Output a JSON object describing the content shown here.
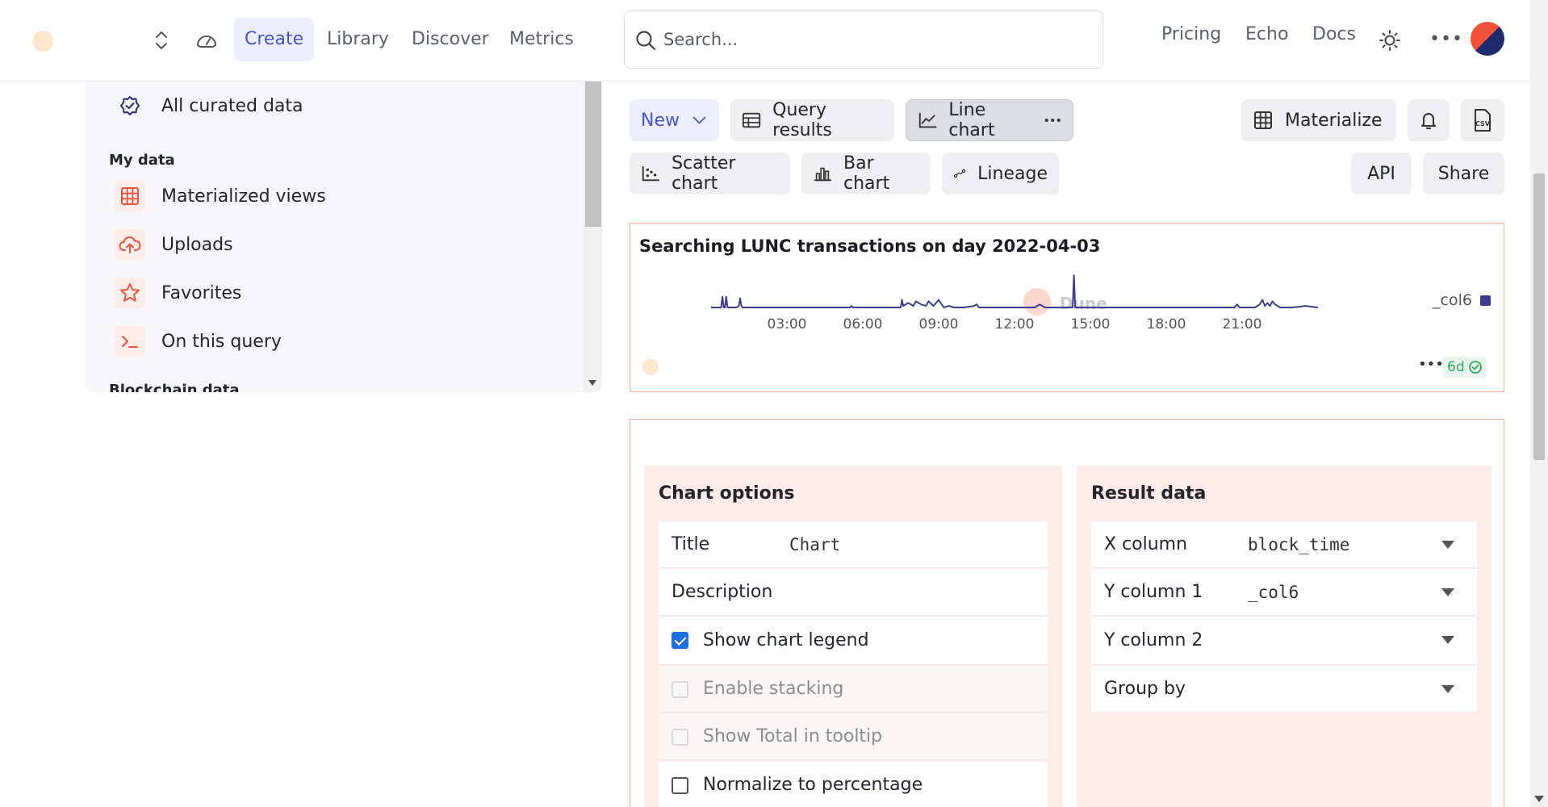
{
  "nav": {
    "items": [
      {
        "label": "Create"
      },
      {
        "label": "Library"
      },
      {
        "label": "Discover"
      },
      {
        "label": "Metrics"
      }
    ],
    "search_placeholder": "Search...",
    "right_links": [
      {
        "label": "Pricing"
      },
      {
        "label": "Echo"
      },
      {
        "label": "Docs"
      }
    ],
    "more_label": "•••"
  },
  "sidebar": {
    "curated": {
      "label": "All curated data",
      "icon": "shield-check-icon"
    },
    "my_data_heading": "My data",
    "items": [
      {
        "label": "Materialized views",
        "icon": "grid-table-icon"
      },
      {
        "label": "Uploads",
        "icon": "cloud-upload-icon"
      },
      {
        "label": "Favorites",
        "icon": "star-icon"
      },
      {
        "label": "On this query",
        "icon": "terminal-icon"
      }
    ],
    "blockchain_heading": "Blockchain data"
  },
  "toolbar": {
    "new_label": "New",
    "query_results": "Query results",
    "line_chart": "Line chart",
    "materialize": "Materialize",
    "scatter_chart": "Scatter chart",
    "bar_chart": "Bar chart",
    "lineage": "Lineage",
    "api": "API",
    "share": "Share"
  },
  "chart": {
    "more_label": "•••",
    "age_badge": "6d",
    "watermark": "Dune"
  },
  "chart_data": {
    "type": "line",
    "title": "Searching LUNC transactions on day 2022-04-03",
    "x_tick_labels": [
      "03:00",
      "06:00",
      "09:00",
      "12:00",
      "15:00",
      "18:00",
      "21:00"
    ],
    "xlim": [
      "00:00",
      "24:00"
    ],
    "series": [
      {
        "name": "_col6",
        "color": "#3d3d8f",
        "x": [
          0.0,
          0.4,
          0.45,
          0.5,
          0.55,
          0.6,
          0.65,
          0.8,
          1.0,
          1.1,
          1.15,
          1.2,
          1.25,
          1.5,
          2.0,
          3.0,
          4.0,
          5.0,
          5.5,
          5.55,
          5.6,
          6.0,
          7.0,
          7.5,
          7.55,
          7.6,
          7.8,
          8.0,
          8.1,
          8.3,
          8.5,
          8.6,
          8.8,
          9.0,
          9.2,
          9.4,
          9.6,
          9.8,
          10.0,
          10.4,
          10.5,
          10.6,
          11.0,
          12.0,
          12.8,
          13.0,
          13.2,
          14.0,
          14.3,
          14.35,
          14.4,
          14.5,
          15.0,
          16.0,
          17.0,
          17.5,
          18.0,
          19.0,
          20.0,
          20.7,
          20.8,
          20.9,
          21.0,
          21.5,
          21.7,
          21.8,
          21.9,
          22.0,
          22.1,
          22.2,
          22.3,
          22.4,
          22.5,
          23.0,
          23.5,
          24.0
        ],
        "values": [
          1,
          1,
          8,
          1,
          1,
          8,
          1,
          1,
          1,
          2,
          7,
          2,
          1,
          1,
          1,
          1,
          1,
          1,
          1,
          2,
          1,
          1,
          1,
          1,
          6,
          2,
          4,
          2,
          5,
          3,
          2,
          5,
          2,
          6,
          1,
          2,
          1,
          1,
          1,
          2,
          3,
          1,
          1,
          1,
          1,
          3,
          1,
          1,
          1,
          22,
          1,
          1,
          1,
          1,
          1,
          1,
          1,
          1,
          1,
          1,
          3,
          1,
          1,
          1,
          3,
          6,
          2,
          4,
          2,
          5,
          3,
          2,
          1,
          1,
          2,
          1
        ]
      }
    ],
    "legend": "right",
    "grid": false
  },
  "options": {
    "title": "Chart options",
    "title_field_label": "Title",
    "title_field_value": "Chart",
    "description_label": "Description",
    "show_legend": "Show chart legend",
    "enable_stacking": "Enable stacking",
    "show_total": "Show Total in tooltip",
    "normalize": "Normalize to percentage"
  },
  "result_data": {
    "title": "Result data",
    "x_column_label": "X column",
    "x_column_value": "block_time",
    "y1_label": "Y column 1",
    "y1_value": "_col6",
    "y2_label": "Y column 2",
    "group_by_label": "Group by"
  }
}
